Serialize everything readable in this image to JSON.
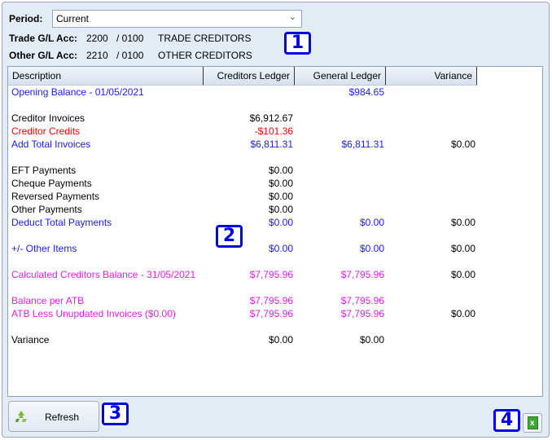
{
  "period": {
    "label": "Period:",
    "value": "Current"
  },
  "accounts": [
    {
      "label": "Trade G/L Acc:",
      "code": "2200",
      "sub": "/ 0100",
      "name": "TRADE CREDITORS"
    },
    {
      "label": "Other G/L Acc:",
      "code": "2210",
      "sub": "/ 0100",
      "name": "OTHER CREDITORS"
    }
  ],
  "badges": [
    "1",
    "2",
    "3",
    "4"
  ],
  "table": {
    "headers": [
      "Description",
      "Creditors Ledger",
      "General Ledger",
      "Variance"
    ],
    "rows": [
      {
        "desc": "Opening Balance - 01/05/2021",
        "cl": "",
        "gl": "$984.65",
        "var": "",
        "color": "blue",
        "var_color": "black"
      },
      {
        "desc": "Creditor Invoices",
        "cl": "$6,912.67",
        "gl": "",
        "var": "",
        "color": "black",
        "var_color": "black"
      },
      {
        "desc": "Creditor Credits",
        "cl": "-$101.36",
        "gl": "",
        "var": "",
        "color": "red",
        "var_color": "black"
      },
      {
        "desc": "Add Total Invoices",
        "cl": "$6,811.31",
        "gl": "$6,811.31",
        "var": "$0.00",
        "color": "blue",
        "var_color": "black"
      },
      {
        "desc": "EFT Payments",
        "cl": "$0.00",
        "gl": "",
        "var": "",
        "color": "black",
        "var_color": "black"
      },
      {
        "desc": "Cheque Payments",
        "cl": "$0.00",
        "gl": "",
        "var": "",
        "color": "black",
        "var_color": "black"
      },
      {
        "desc": "Reversed Payments",
        "cl": "$0.00",
        "gl": "",
        "var": "",
        "color": "black",
        "var_color": "black"
      },
      {
        "desc": "Other Payments",
        "cl": "$0.00",
        "gl": "",
        "var": "",
        "color": "black",
        "var_color": "black"
      },
      {
        "desc": "Deduct Total Payments",
        "cl": "$0.00",
        "gl": "$0.00",
        "var": "$0.00",
        "color": "blue",
        "var_color": "black"
      },
      {
        "desc": "+/- Other Items",
        "cl": "$0.00",
        "gl": "$0.00",
        "var": "$0.00",
        "color": "blue",
        "var_color": "black"
      },
      {
        "desc": "Calculated Creditors Balance - 31/05/2021",
        "cl": "$7,795.96",
        "gl": "$7,795.96",
        "var": "$0.00",
        "color": "magenta",
        "var_color": "black"
      },
      {
        "desc": "Balance per ATB",
        "cl": "$7,795.96",
        "gl": "$7,795.96",
        "var": "",
        "color": "magenta",
        "var_color": "black"
      },
      {
        "desc": "ATB Less Unupdated Invoices ($0.00)",
        "cl": "$7,795.96",
        "gl": "$7,795.96",
        "var": "$0.00",
        "color": "magenta",
        "var_color": "black"
      },
      {
        "desc": "Variance",
        "cl": "$0.00",
        "gl": "$0.00",
        "var": "",
        "color": "black",
        "var_color": "black"
      }
    ]
  },
  "buttons": {
    "refresh": "Refresh",
    "refresh_icon": "recycle-icon",
    "export_icon": "excel-export-icon"
  }
}
